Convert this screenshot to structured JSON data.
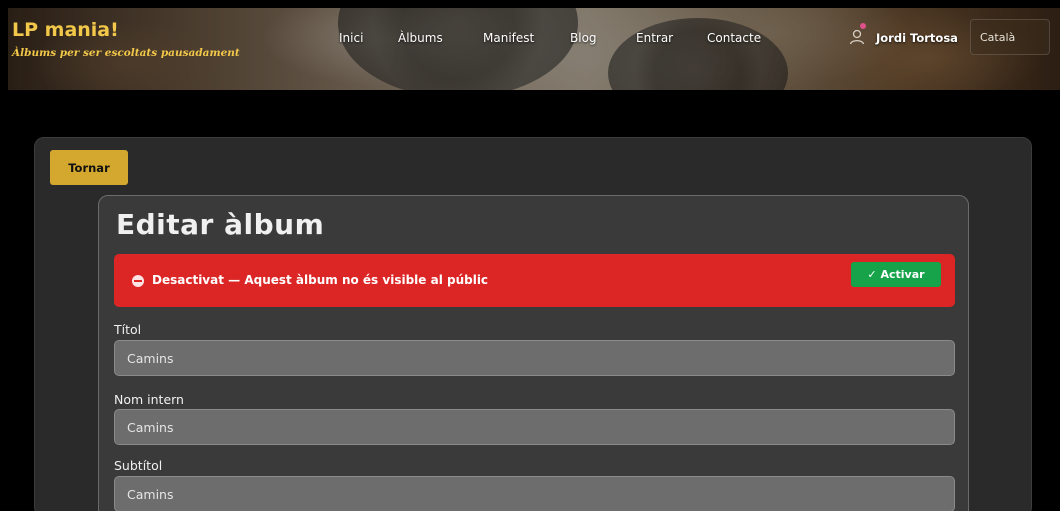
{
  "header": {
    "brand_title": "LP mania!",
    "brand_subtitle": "Àlbums per ser escoltats pausadament",
    "nav": [
      "Inici",
      "Àlbums",
      "Manifest",
      "Blog",
      "Entrar",
      "Contacte"
    ],
    "user_name": "Jordi Tortosa",
    "language": "Català"
  },
  "back_label": "Tornar",
  "form": {
    "title": "Editar àlbum",
    "alert_text": "Desactivat — Aquest àlbum no és visible al públic",
    "activate_label": "✓ Activar",
    "fields": [
      {
        "label": "Títol",
        "value": "Camins"
      },
      {
        "label": "Nom intern",
        "value": "Camins"
      },
      {
        "label": "Subtítol",
        "value": "Camins"
      }
    ]
  },
  "colors": {
    "brand": "#f2c84a",
    "back_button": "#d4a82e",
    "alert": "#dc2626",
    "activate": "#16a34a"
  }
}
